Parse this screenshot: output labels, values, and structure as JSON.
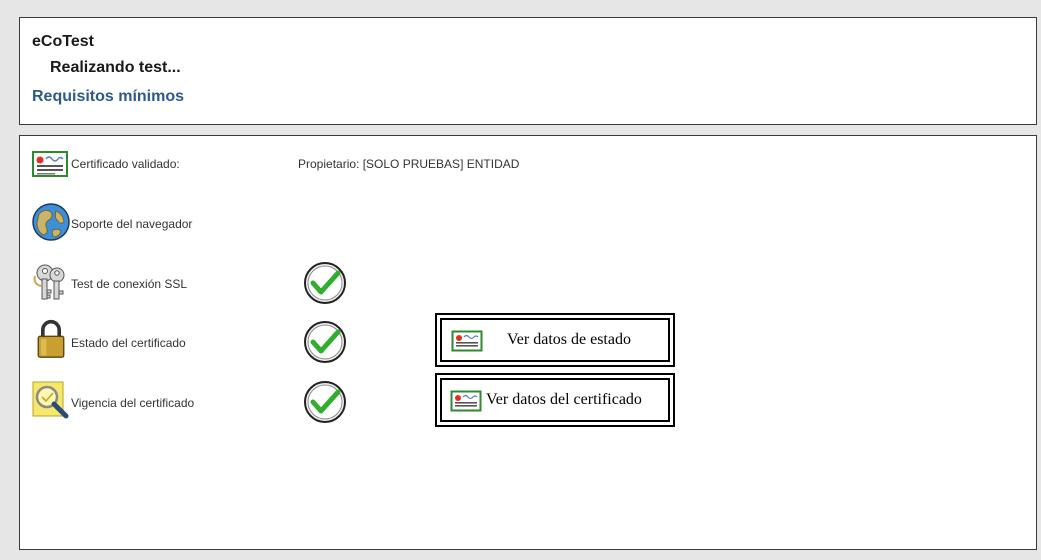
{
  "header": {
    "app_title": "eCoTest",
    "status": "Realizando test...",
    "requirements_link": "Requisitos mínimos"
  },
  "checks": {
    "certificate": {
      "label": "Certificado validado:",
      "value": "Propietario: [SOLO PRUEBAS] ENTIDAD",
      "icon": "certificate-icon"
    },
    "browser": {
      "label": "Soporte del navegador",
      "icon": "globe-icon"
    },
    "ssl": {
      "label": "Test de conexión SSL",
      "icon": "keys-icon",
      "status": "ok"
    },
    "cert_status": {
      "label": "Estado del certificado",
      "icon": "padlock-icon",
      "status": "ok",
      "button": "Ver datos de estado"
    },
    "validity": {
      "label": "Vigencia del certificado",
      "icon": "certificate-search-icon",
      "status": "ok",
      "button": "Ver datos del certificado"
    }
  },
  "colors": {
    "link": "#2d5a8a",
    "check_green": "#2fae2f",
    "border": "#3b3b3b",
    "background": "#e6e6e6"
  }
}
